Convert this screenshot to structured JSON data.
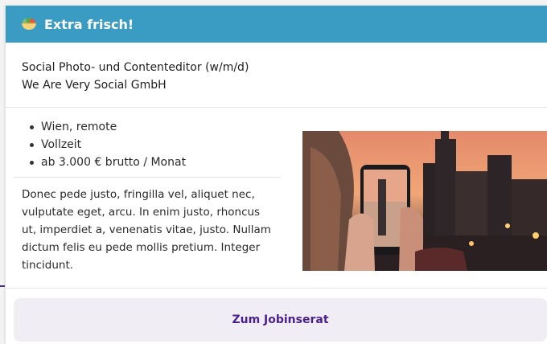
{
  "header": {
    "title": "Extra frisch!",
    "icon": "salad-bowl-icon"
  },
  "job": {
    "title": "Social Photo- und Contenteditor (w/m/d)",
    "company": "We Are Very Social GmbH"
  },
  "facts": [
    "Wien, remote",
    "Vollzeit",
    "ab 3.000 € brutto / Monat"
  ],
  "description": "Donec pede justo, fringilla vel, aliquet nec, vulputate eget, arcu. In enim justo, rhoncus ut, imperdiet a, venenatis vitae, justo. Nullam dictum felis eu pede mollis pretium. Integer tincidunt.",
  "cta": {
    "label": "Zum Jobinserat"
  },
  "colors": {
    "header_bg": "#3a9bc3",
    "cta_text": "#4a1f8f",
    "cta_bg": "#f0eef4"
  }
}
